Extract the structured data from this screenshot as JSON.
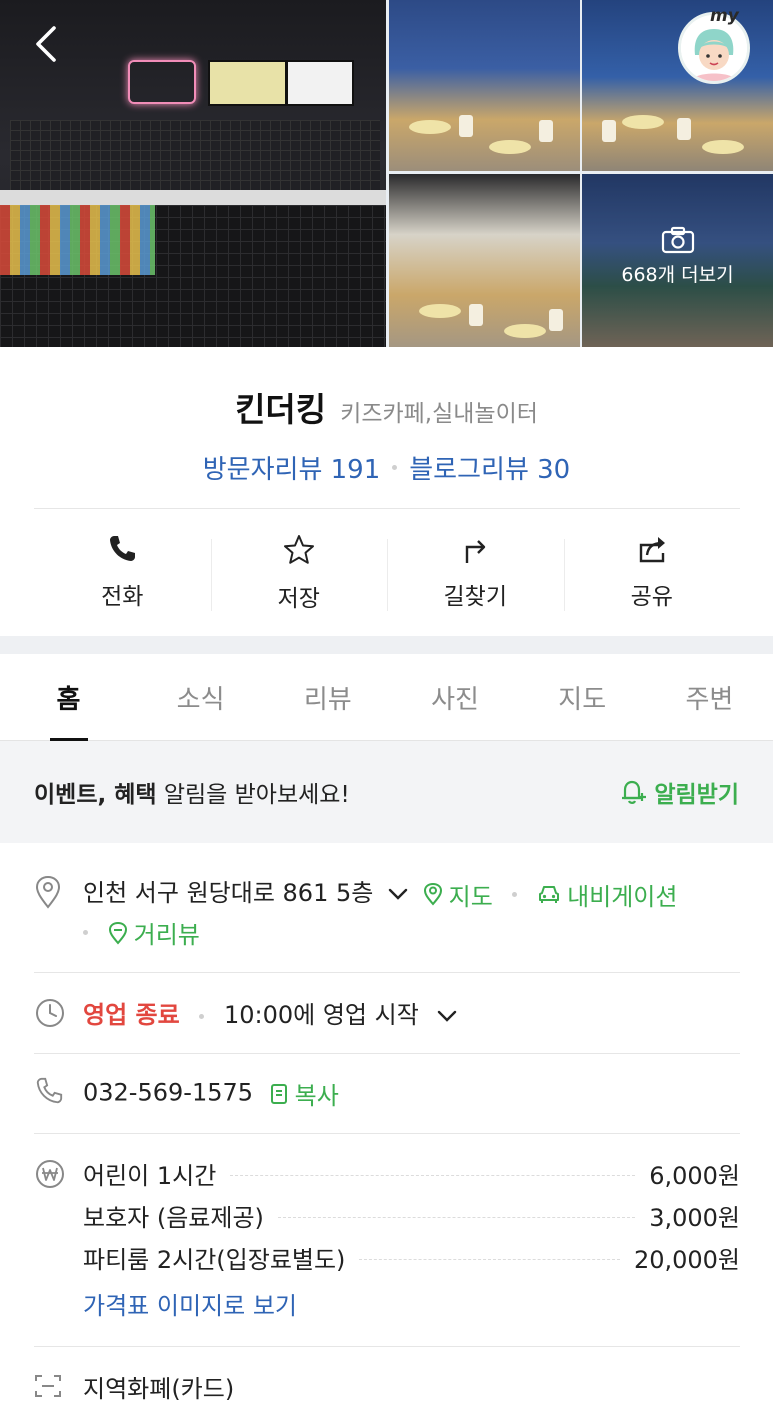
{
  "gallery": {
    "more_photos_label": "668개 더보기",
    "my_badge": "my"
  },
  "place": {
    "name": "킨더킹",
    "category": "키즈카페,실내놀이터",
    "visitor_reviews": "방문자리뷰 191",
    "blog_reviews": "블로그리뷰 30"
  },
  "actions": [
    {
      "label": "전화",
      "icon": "phone-icon"
    },
    {
      "label": "저장",
      "icon": "star-icon"
    },
    {
      "label": "길찾기",
      "icon": "directions-icon"
    },
    {
      "label": "공유",
      "icon": "share-icon"
    }
  ],
  "tabs": [
    {
      "label": "홈",
      "active": true
    },
    {
      "label": "소식"
    },
    {
      "label": "리뷰"
    },
    {
      "label": "사진"
    },
    {
      "label": "지도"
    },
    {
      "label": "주변"
    }
  ],
  "notice": {
    "bold": "이벤트, 혜택",
    "text": " 알림을 받아보세요!",
    "action": "알림받기"
  },
  "address": {
    "text": "인천 서구 원당대로 861 5층",
    "map_link": "지도",
    "navigation_link": "내비게이션",
    "street_view_link": "거리뷰"
  },
  "hours": {
    "status": "영업 종료",
    "next": "10:00에 영업 시작"
  },
  "phone": {
    "number": "032-569-1575",
    "copy_label": "복사"
  },
  "prices": {
    "items": [
      {
        "name": "어린이 1시간",
        "price": "6,000원"
      },
      {
        "name": "보호자 (음료제공)",
        "price": "3,000원"
      },
      {
        "name": "파티룸 2시간(입장료별도)",
        "price": "20,000원"
      }
    ],
    "image_link": "가격표 이미지로 보기"
  },
  "payment": {
    "text": "지역화폐(카드)"
  },
  "colors": {
    "accent_green": "#3cae4f",
    "link_blue": "#2f64b5",
    "closed_red": "#e2473f"
  }
}
